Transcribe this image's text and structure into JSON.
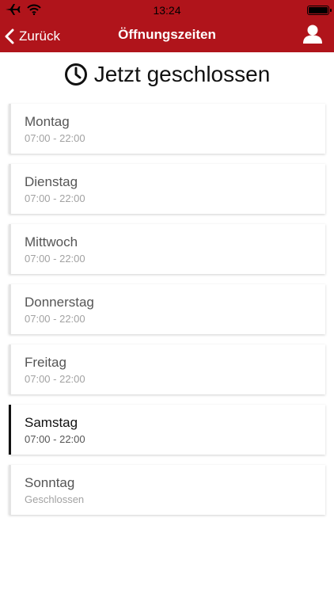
{
  "status_bar": {
    "time": "13:24"
  },
  "nav": {
    "back_label": "Zurück",
    "title": "Öffnungszeiten"
  },
  "header": {
    "status_text": "Jetzt geschlossen"
  },
  "days": [
    {
      "name": "Montag",
      "hours": "07:00 - 22:00"
    },
    {
      "name": "Dienstag",
      "hours": "07:00 - 22:00"
    },
    {
      "name": "Mittwoch",
      "hours": "07:00 - 22:00"
    },
    {
      "name": "Donnerstag",
      "hours": "07:00 - 22:00"
    },
    {
      "name": "Freitag",
      "hours": "07:00 - 22:00"
    },
    {
      "name": "Samstag",
      "hours": "07:00 - 22:00"
    },
    {
      "name": "Sonntag",
      "hours": "Geschlossen"
    }
  ],
  "colors": {
    "brand": "#b0141b",
    "active_border": "#111111",
    "inactive_border": "#e4e4e4"
  }
}
